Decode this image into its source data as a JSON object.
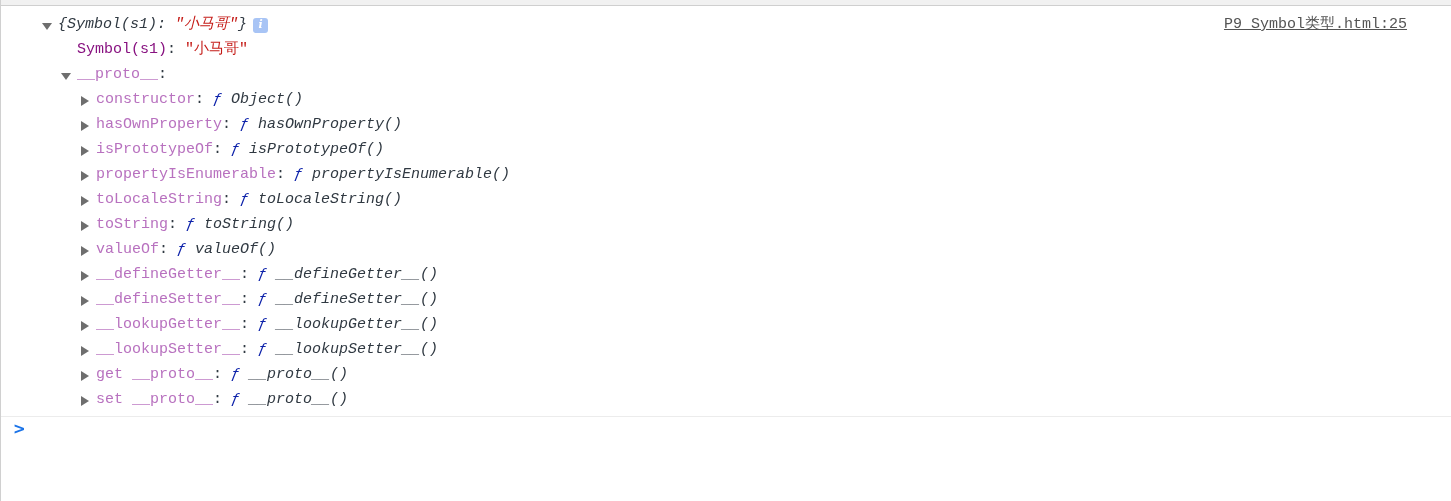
{
  "console": {
    "message": {
      "source_link": "P9_Symbol类型.html:25",
      "separator": ":",
      "root": {
        "expanded": true,
        "preview_open": "{",
        "preview_key": "Symbol(s1)",
        "preview_value": "\"小马哥\"",
        "preview_close": "}",
        "info_badge": "i",
        "children": [
          {
            "kind": "string",
            "key": "Symbol(s1)",
            "dimmed": false,
            "value": "\"小马哥\""
          },
          {
            "kind": "object",
            "key": "__proto__",
            "dimmed": true,
            "expanded": true,
            "children": [
              {
                "kind": "function",
                "key": "constructor",
                "dimmed": true,
                "expanded": false,
                "f": "ƒ",
                "value": "Object()"
              },
              {
                "kind": "function",
                "key": "hasOwnProperty",
                "dimmed": true,
                "expanded": false,
                "f": "ƒ",
                "value": "hasOwnProperty()"
              },
              {
                "kind": "function",
                "key": "isPrototypeOf",
                "dimmed": true,
                "expanded": false,
                "f": "ƒ",
                "value": "isPrototypeOf()"
              },
              {
                "kind": "function",
                "key": "propertyIsEnumerable",
                "dimmed": true,
                "expanded": false,
                "f": "ƒ",
                "value": "propertyIsEnumerable()"
              },
              {
                "kind": "function",
                "key": "toLocaleString",
                "dimmed": true,
                "expanded": false,
                "f": "ƒ",
                "value": "toLocaleString()"
              },
              {
                "kind": "function",
                "key": "toString",
                "dimmed": true,
                "expanded": false,
                "f": "ƒ",
                "value": "toString()"
              },
              {
                "kind": "function",
                "key": "valueOf",
                "dimmed": true,
                "expanded": false,
                "f": "ƒ",
                "value": "valueOf()"
              },
              {
                "kind": "function",
                "key": "__defineGetter__",
                "dimmed": true,
                "expanded": false,
                "f": "ƒ",
                "value": "__defineGetter__()"
              },
              {
                "kind": "function",
                "key": "__defineSetter__",
                "dimmed": true,
                "expanded": false,
                "f": "ƒ",
                "value": "__defineSetter__()"
              },
              {
                "kind": "function",
                "key": "__lookupGetter__",
                "dimmed": true,
                "expanded": false,
                "f": "ƒ",
                "value": "__lookupGetter__()"
              },
              {
                "kind": "function",
                "key": "__lookupSetter__",
                "dimmed": true,
                "expanded": false,
                "f": "ƒ",
                "value": "__lookupSetter__()"
              },
              {
                "kind": "function",
                "key": "get __proto__",
                "dimmed": true,
                "expanded": false,
                "f": "ƒ",
                "value": "__proto__()"
              },
              {
                "kind": "function",
                "key": "set __proto__",
                "dimmed": true,
                "expanded": false,
                "f": "ƒ",
                "value": "__proto__()"
              }
            ]
          }
        ]
      }
    },
    "prompt": {
      "symbol": ">"
    }
  }
}
